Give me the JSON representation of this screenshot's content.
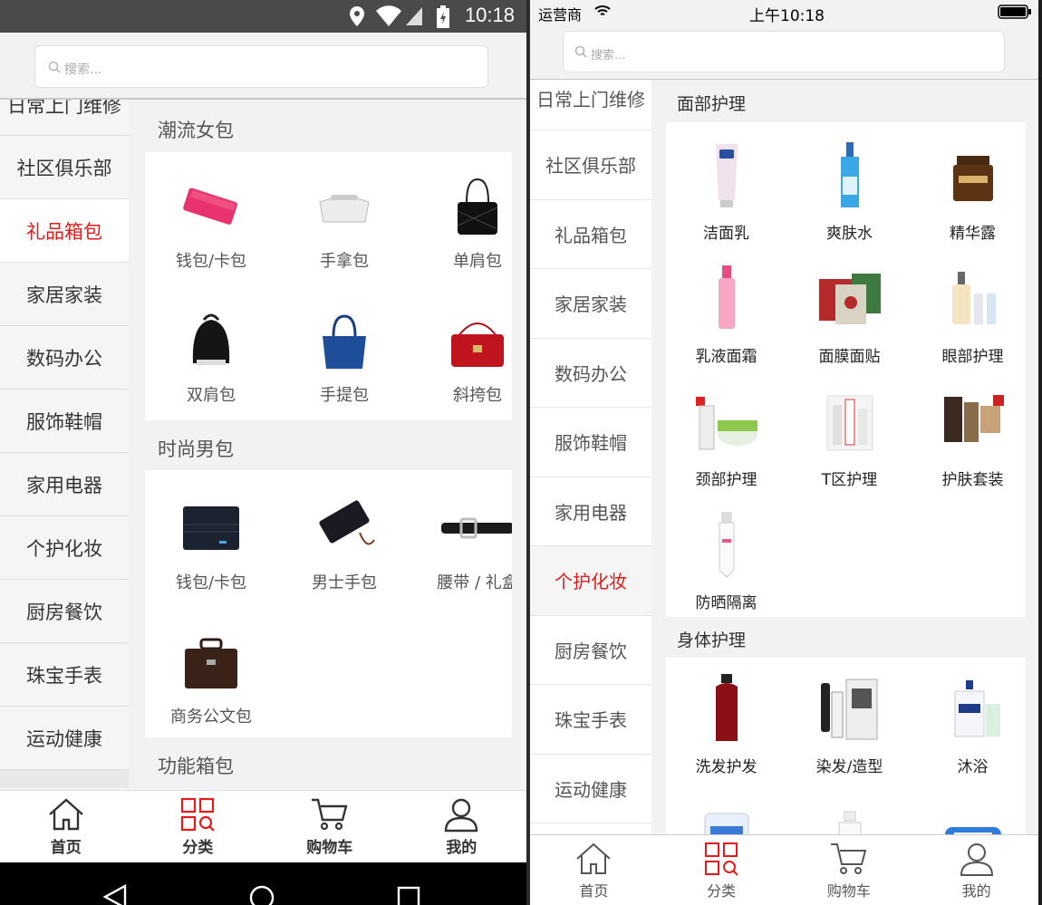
{
  "android": {
    "status": {
      "time": "10:18"
    },
    "search": {
      "placeholder": "搜索..."
    },
    "sidebar": [
      "日常上门维修",
      "社区俱乐部",
      "礼品箱包",
      "家居家装",
      "数码办公",
      "服饰鞋帽",
      "家用电器",
      "个护化妆",
      "厨房餐饮",
      "珠宝手表",
      "运动健康"
    ],
    "active_category": "礼品箱包",
    "sections": [
      {
        "title": "潮流女包",
        "items": [
          "钱包/卡包",
          "手拿包",
          "单肩包",
          "双肩包",
          "手提包",
          "斜挎包"
        ]
      },
      {
        "title": "时尚男包",
        "items": [
          "钱包/卡包",
          "男士手包",
          "腰带 / 礼盒",
          "商务公文包"
        ]
      },
      {
        "title": "功能箱包",
        "items": []
      }
    ],
    "tabs": [
      "首页",
      "分类",
      "购物车",
      "我的"
    ],
    "active_tab": "分类"
  },
  "ios": {
    "status": {
      "carrier": "运营商",
      "time": "上午10:18"
    },
    "search": {
      "placeholder": "搜索..."
    },
    "sidebar": [
      "日常上门维修",
      "社区俱乐部",
      "礼品箱包",
      "家居家装",
      "数码办公",
      "服饰鞋帽",
      "家用电器",
      "个护化妆",
      "厨房餐饮",
      "珠宝手表",
      "运动健康"
    ],
    "active_category": "个护化妆",
    "sections": [
      {
        "title": "面部护理",
        "items": [
          "洁面乳",
          "爽肤水",
          "精华露",
          "乳液面霜",
          "面膜面贴",
          "眼部护理",
          "颈部护理",
          "T区护理",
          "护肤套装",
          "防晒隔离"
        ]
      },
      {
        "title": "身体护理",
        "items": [
          "洗发护发",
          "染发/造型",
          "沐浴"
        ]
      }
    ],
    "tabs": [
      "首页",
      "分类",
      "购物车",
      "我的"
    ],
    "active_tab": "分类"
  },
  "colors": {
    "accent": "#e31b1b",
    "background": "#f2f2f4"
  }
}
